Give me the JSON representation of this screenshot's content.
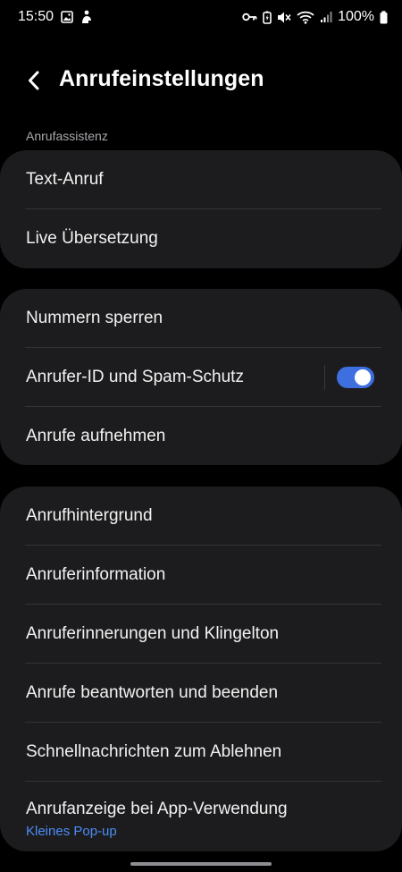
{
  "status_bar": {
    "time": "15:50",
    "battery": "100%"
  },
  "header": {
    "title": "Anrufeinstellungen"
  },
  "sections": {
    "assist_label": "Anrufassistenz"
  },
  "card1": {
    "items": [
      {
        "label": "Text-Anruf"
      },
      {
        "label": "Live Übersetzung"
      }
    ]
  },
  "card2": {
    "items": [
      {
        "label": "Nummern sperren"
      },
      {
        "label": "Anrufer-ID und Spam-Schutz",
        "toggle_on": true
      },
      {
        "label": "Anrufe aufnehmen"
      }
    ]
  },
  "card3": {
    "items": [
      {
        "label": "Anrufhintergrund"
      },
      {
        "label": "Anruferinformation"
      },
      {
        "label": "Anruferinnerungen und Klingelton"
      },
      {
        "label": "Anrufe beantworten und beenden"
      },
      {
        "label": "Schnellnachrichten zum Ablehnen"
      },
      {
        "label": "Anrufanzeige bei App-Verwendung",
        "sub": "Kleines Pop-up"
      }
    ]
  },
  "colors": {
    "background": "#000000",
    "card": "#1c1c1e",
    "accent": "#3e6fe0",
    "sub_text": "#4c8cf5"
  }
}
